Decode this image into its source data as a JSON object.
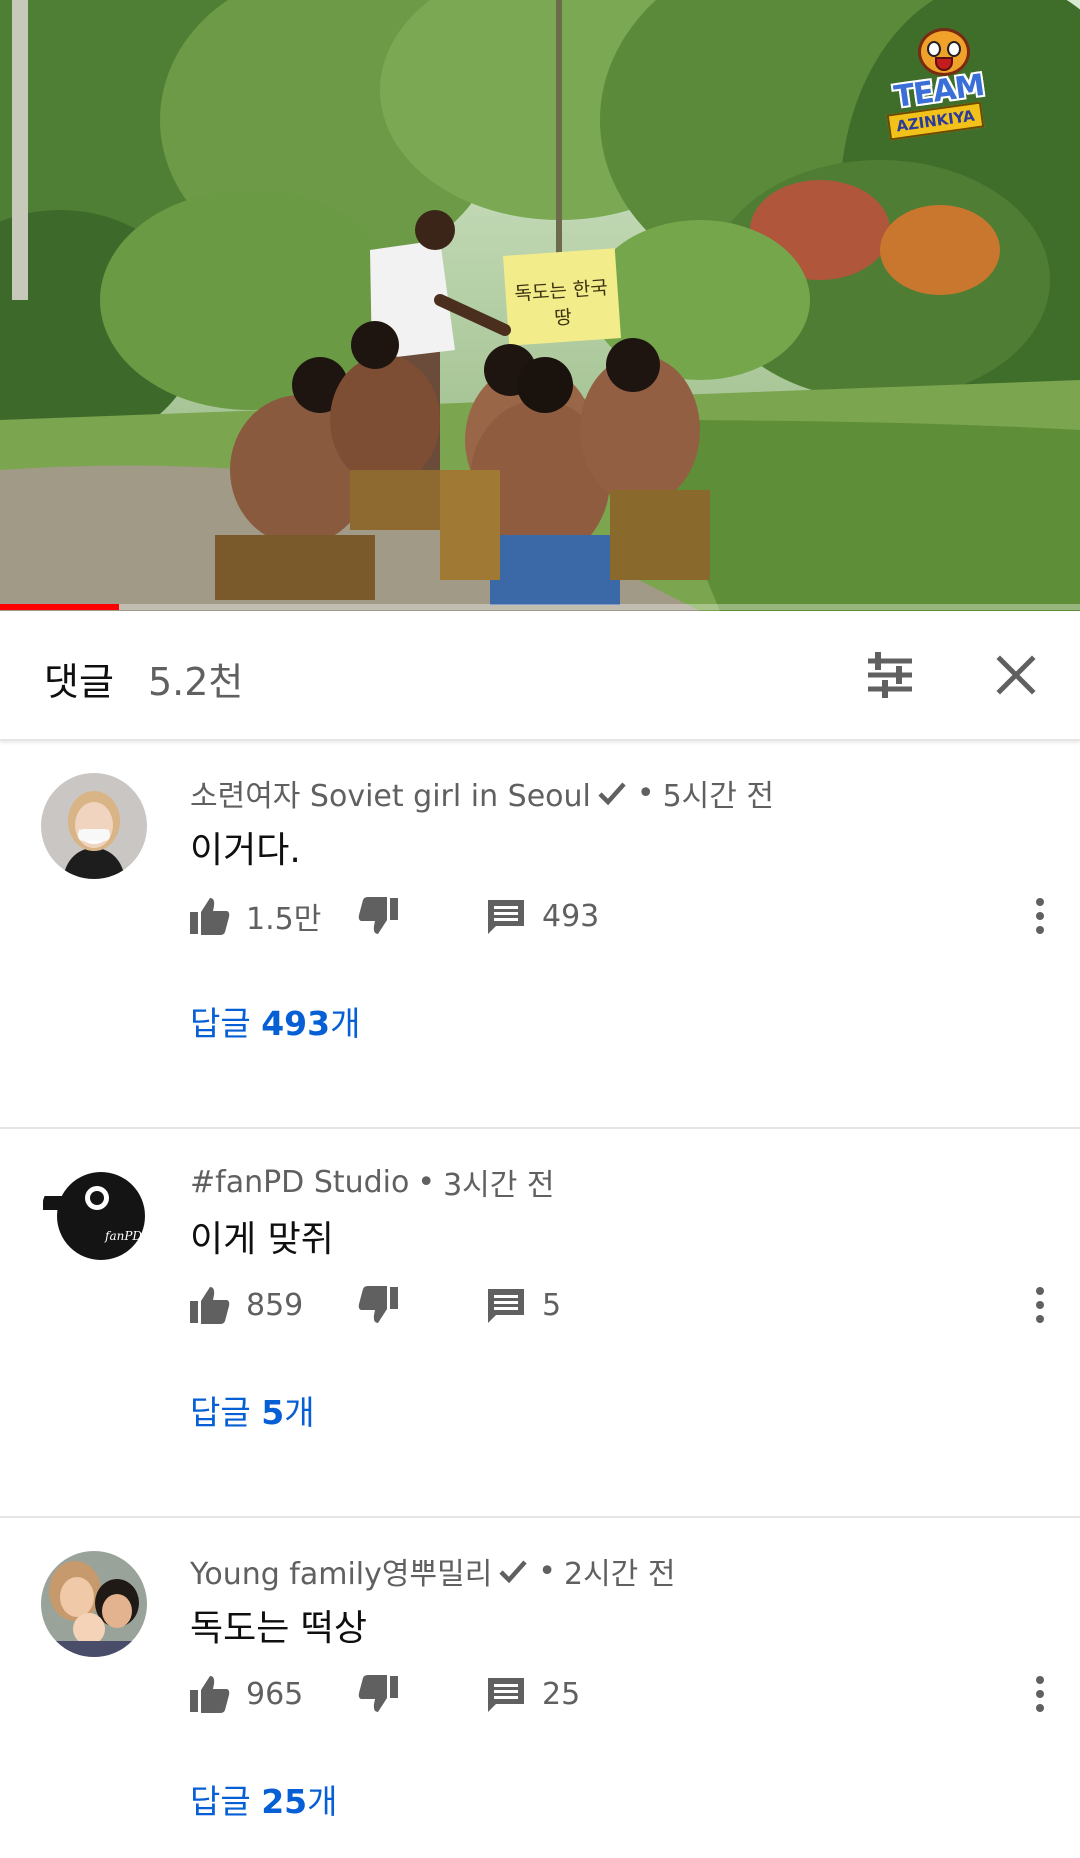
{
  "video": {
    "sign_text": "독도는 한국땅",
    "watermark": {
      "line1": "TEAM",
      "line2": "AZINKIYA"
    },
    "progress": 0.11
  },
  "comments_header": {
    "title": "댓글",
    "count": "5.2천",
    "icons": {
      "filter": "sort-filter-icon",
      "close": "close-icon"
    }
  },
  "comments": [
    {
      "author": "소련여자 Soviet girl in Seoul",
      "verified": true,
      "time": "5시간 전",
      "text": "이거다.",
      "likes": "1.5만",
      "reply_count": "493",
      "replies_prefix": "답글 ",
      "replies_number": "493",
      "replies_suffix": "개"
    },
    {
      "author": "#fanPD Studio",
      "verified": false,
      "time": "3시간 전",
      "text": "이게 맞쥐",
      "likes": "859",
      "reply_count": "5",
      "replies_prefix": "답글 ",
      "replies_number": "5",
      "replies_suffix": "개"
    },
    {
      "author": "Young family영뿌밀리",
      "verified": true,
      "time": "2시간 전",
      "text": "독도는 떡상",
      "likes": "965",
      "reply_count": "25",
      "replies_prefix": "답글 ",
      "replies_number": "25",
      "replies_suffix": "개"
    }
  ],
  "colors": {
    "link": "#065fd4",
    "secondary_text": "#606060",
    "primary_text": "#0f0f0f",
    "progress": "#ff0000",
    "divider": "#e5e5e5"
  }
}
